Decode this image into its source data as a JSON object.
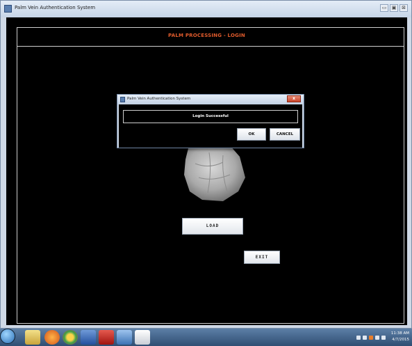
{
  "window": {
    "title": "Palm Vein Authentication System",
    "controls": [
      "▭",
      "▣",
      "⊠"
    ]
  },
  "screen": {
    "title": "PALM PROCESSING - LOGIN",
    "load_label": "LOAD",
    "exit_label": "EXIT"
  },
  "dialog": {
    "title": "Palm Vein Authentication System",
    "close_label": "x",
    "message": "Login Successful",
    "ok_label": "OK",
    "cancel_label": "CANCEL"
  },
  "taskbar": {
    "apps": [
      "start-orb",
      "file-explorer-icon",
      "firefox-icon",
      "chrome-icon",
      "word-icon",
      "acrobat-icon",
      "virtualbox-icon",
      "java-icon"
    ],
    "clock_time": "11:38 AM",
    "clock_date": "4/7/2015"
  },
  "colors": {
    "accent_title": "#e05b2c",
    "background": "#000000"
  }
}
